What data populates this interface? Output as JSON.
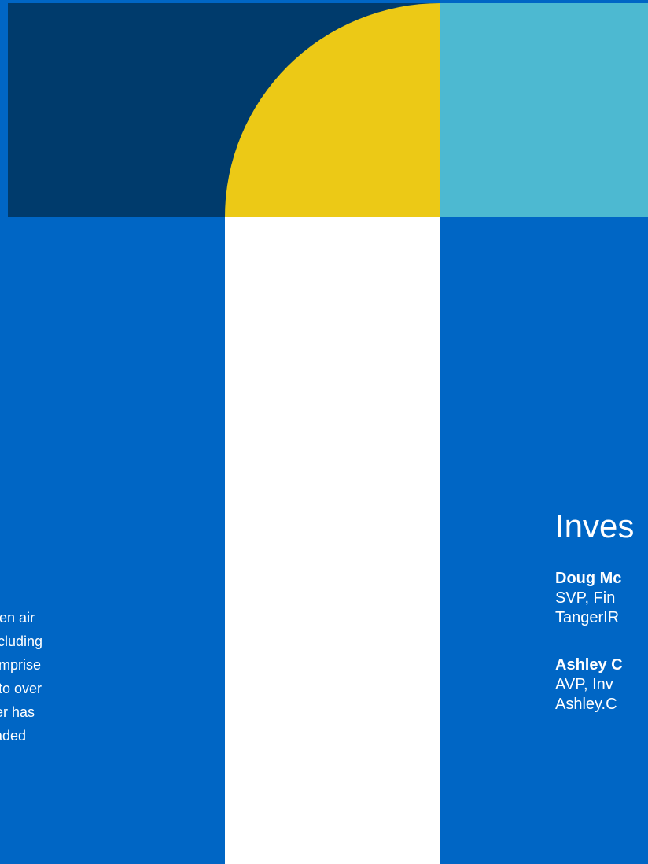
{
  "about": {
    "lines": [
      "e open air",
      "s, including",
      "n comprise",
      "sed to over",
      "anger has",
      "ly traded"
    ]
  },
  "investor_contacts": {
    "title": "Inves",
    "contacts": [
      {
        "name": "Doug Mc",
        "role": "SVP, Fin",
        "email": "TangerIR"
      },
      {
        "name": "Ashley C",
        "role": "AVP, Inv",
        "email": "Ashley.C"
      }
    ]
  },
  "colors": {
    "background": "#0066c5",
    "navy": "#003b6c",
    "yellow": "#ecc916",
    "teal": "#4db9d1",
    "white": "#ffffff"
  }
}
